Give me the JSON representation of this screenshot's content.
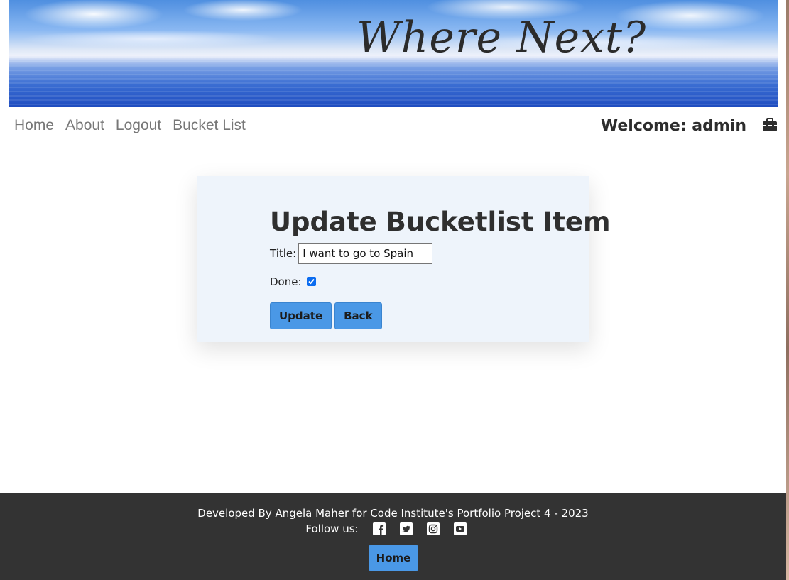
{
  "banner": {
    "title": "Where Next?"
  },
  "nav": {
    "items": [
      {
        "label": "Home"
      },
      {
        "label": "About"
      },
      {
        "label": "Logout"
      },
      {
        "label": "Bucket List"
      }
    ],
    "welcome": "Welcome: admin",
    "user_icon": "toolbox-icon"
  },
  "form": {
    "heading": "Update Bucketlist Item",
    "title_label": "Title:",
    "title_value": "I want to go to Spain",
    "done_label": "Done:",
    "done_checked": true,
    "update_label": "Update",
    "back_label": "Back"
  },
  "footer": {
    "credit": "Developed By Angela Maher for Code Institute's Portfolio Project 4 - 2023",
    "follow_label": "Follow us:",
    "social_icons": [
      "facebook-icon",
      "twitter-icon",
      "instagram-icon",
      "youtube-icon"
    ],
    "home_label": "Home"
  },
  "colors": {
    "button": "#4a98e6",
    "card_bg": "#eef4fb",
    "footer_bg": "#333333",
    "checkbox": "#0b6cf0"
  }
}
